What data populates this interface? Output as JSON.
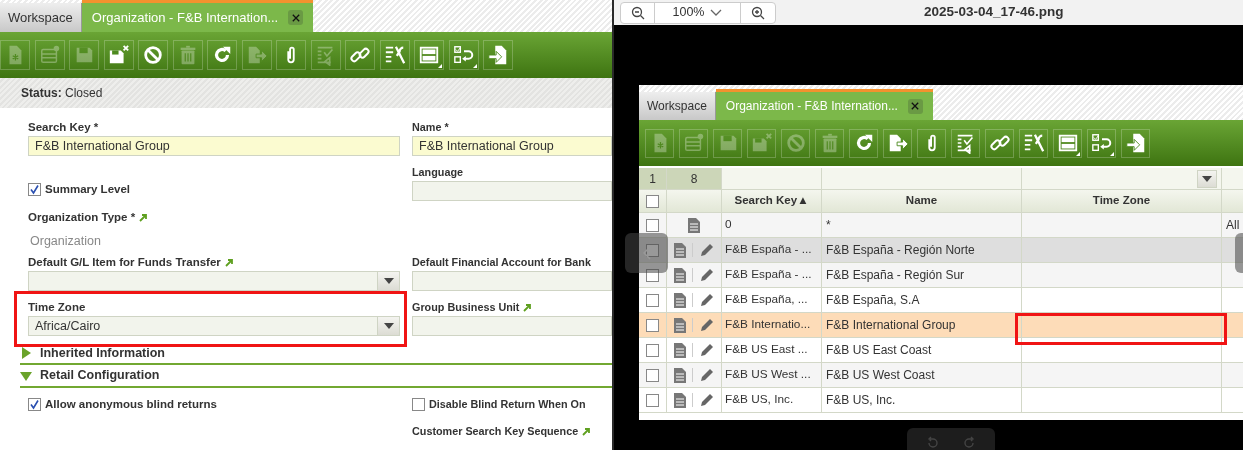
{
  "form_window": {
    "tabs": [
      {
        "label": "Workspace",
        "selected": false,
        "closable": false
      },
      {
        "label": "Organization - F&B Internation...",
        "selected": true,
        "closable": true
      }
    ],
    "toolbar": [
      {
        "kind": "new",
        "disabled": true,
        "dropdown": false
      },
      {
        "kind": "newrow",
        "disabled": true,
        "dropdown": false
      },
      {
        "kind": "save",
        "disabled": true,
        "dropdown": false
      },
      {
        "kind": "saveclose",
        "disabled": false,
        "dropdown": false
      },
      {
        "kind": "cancel",
        "disabled": false,
        "dropdown": false
      },
      {
        "kind": "delete",
        "disabled": true,
        "dropdown": false
      },
      {
        "kind": "refresh",
        "disabled": false,
        "dropdown": false
      },
      {
        "kind": "export",
        "disabled": true,
        "dropdown": false
      },
      {
        "kind": "attach",
        "disabled": false,
        "dropdown": false
      },
      {
        "kind": "checklist",
        "disabled": true,
        "dropdown": false
      },
      {
        "kind": "link",
        "disabled": false,
        "dropdown": false
      },
      {
        "kind": "tools",
        "disabled": false,
        "dropdown": false
      },
      {
        "kind": "layout",
        "disabled": false,
        "dropdown": true
      },
      {
        "kind": "toggle",
        "disabled": false,
        "dropdown": true
      },
      {
        "kind": "import",
        "disabled": false,
        "dropdown": false
      }
    ],
    "status": "**Status:** Closed",
    "rows": [
      {
        "left": {
          "kind": "text",
          "label": "Search Key *",
          "value": "F&B International Group",
          "required": true
        },
        "right": {
          "kind": "text",
          "label": "Name *",
          "value": "F&B International Group",
          "required": true
        }
      },
      {
        "left": {
          "kind": "checkbox",
          "label": "Summary Level",
          "checked": true
        },
        "right": {
          "kind": "text",
          "label": "Language",
          "required": false
        }
      },
      {
        "left": {
          "kind": "readonly",
          "label": "Organization Type *",
          "link": true,
          "value": "Organization"
        }
      },
      {
        "left": {
          "kind": "combo",
          "label": "Default G/L Item for Funds Transfer",
          "link": true
        },
        "right": {
          "kind": "text",
          "label": "Default Financial Account for Bank",
          "required": false
        }
      },
      {
        "left": {
          "kind": "combo",
          "label": "Time Zone",
          "value": "Africa/Cairo",
          "marked": true
        },
        "right": {
          "kind": "text",
          "label": "Group Business Unit",
          "link": true,
          "required": false
        }
      }
    ],
    "sections": [
      {
        "title": "Inherited Information",
        "expanded": false
      },
      {
        "title": "Retail Configuration",
        "expanded": true,
        "rows": [
          {
            "left": {
              "kind": "checkbox",
              "label": "Allow anonymous blind returns",
              "checked": true
            },
            "right": {
              "kind": "checkbox",
              "label": "Disable Blind Return When On",
              "checked": false
            }
          },
          {
            "right": {
              "kind": "label",
              "label": "Customer Search Key Sequence",
              "link": true
            }
          }
        ]
      }
    ]
  },
  "image_viewer": {
    "zoom": "100%",
    "filename": "2025-03-04_17-46.png",
    "image": {
      "tabs": [
        {
          "label": "Workspace",
          "selected": false,
          "closable": false
        },
        {
          "label": "Organization - F&B Internation...",
          "selected": true,
          "closable": true
        }
      ],
      "toolbar": [
        {
          "kind": "new",
          "disabled": true,
          "dropdown": false
        },
        {
          "kind": "newrow",
          "disabled": true,
          "dropdown": false
        },
        {
          "kind": "save",
          "disabled": true,
          "dropdown": false
        },
        {
          "kind": "saveclose",
          "disabled": true,
          "dropdown": false
        },
        {
          "kind": "cancel",
          "disabled": true,
          "dropdown": false
        },
        {
          "kind": "delete",
          "disabled": true,
          "dropdown": false
        },
        {
          "kind": "refresh",
          "disabled": false,
          "dropdown": false
        },
        {
          "kind": "export",
          "disabled": false,
          "dropdown": false
        },
        {
          "kind": "attach",
          "disabled": false,
          "dropdown": false
        },
        {
          "kind": "checklist",
          "disabled": false,
          "dropdown": false
        },
        {
          "kind": "link",
          "disabled": false,
          "dropdown": false
        },
        {
          "kind": "tools",
          "disabled": false,
          "dropdown": false
        },
        {
          "kind": "layout",
          "disabled": false,
          "dropdown": true
        },
        {
          "kind": "toggle",
          "disabled": false,
          "dropdown": true
        },
        {
          "kind": "import",
          "disabled": false,
          "dropdown": false
        }
      ],
      "grid": {
        "filter_row": {
          "column_1": "1",
          "column_2": "8"
        },
        "select_all": {
          "checked": false
        },
        "columns": [
          {
            "label": "Search Key",
            "sort": "▲",
            "kind": "text"
          },
          {
            "label": "Name",
            "kind": "text"
          },
          {
            "label": "Time Zone",
            "kind": "combo"
          }
        ],
        "rows": [
          {
            "search_key": "0",
            "name": "*",
            "column_6": "All",
            "editable": false,
            "checked": false,
            "selected": false,
            "hovered": false,
            "marked": false
          },
          {
            "search_key": "F&B España - ...",
            "name": "F&B España - Región Norte",
            "editable": true,
            "checked": false,
            "selected": false,
            "hovered": true,
            "marked": false
          },
          {
            "search_key": "F&B España - ...",
            "name": "F&B España - Región Sur",
            "editable": true,
            "checked": false,
            "selected": false,
            "hovered": false,
            "marked": false
          },
          {
            "search_key": "F&B España, ...",
            "name": "F&B España, S.A",
            "editable": true,
            "checked": false,
            "selected": false,
            "hovered": false,
            "marked": false
          },
          {
            "search_key": "F&B Internatio...",
            "name": "F&B International Group",
            "editable": true,
            "checked": false,
            "selected": true,
            "hovered": false,
            "marked": true
          },
          {
            "search_key": "F&B US East ...",
            "name": "F&B US East Coast",
            "editable": true,
            "checked": false,
            "selected": false,
            "hovered": false,
            "marked": false
          },
          {
            "search_key": "F&B US West ...",
            "name": "F&B US West Coast",
            "editable": true,
            "checked": false,
            "selected": false,
            "hovered": false,
            "marked": false
          },
          {
            "search_key": "F&B US, Inc.",
            "name": "F&B US, Inc.",
            "editable": true,
            "checked": false,
            "selected": false,
            "hovered": false,
            "marked": false
          }
        ]
      }
    }
  }
}
